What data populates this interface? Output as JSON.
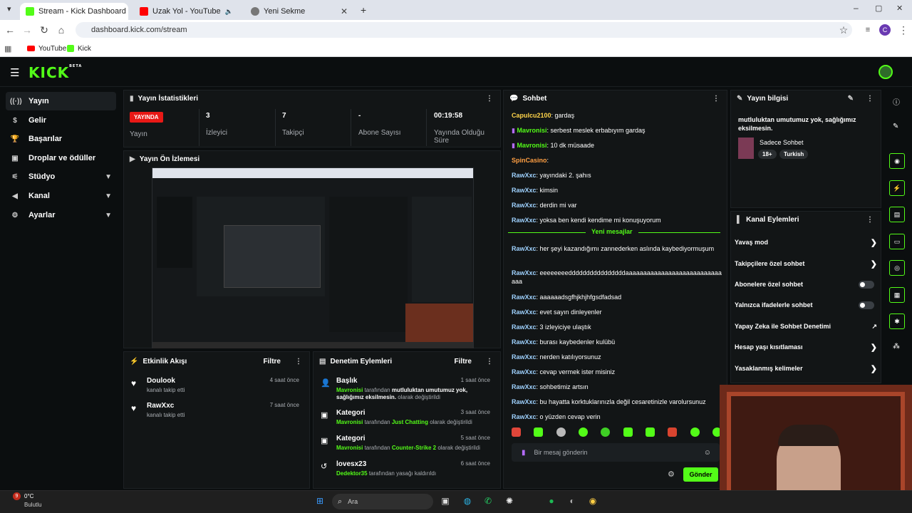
{
  "browser": {
    "tabs": [
      {
        "title": "Stream - Kick Dashboard",
        "color": "#53fc18"
      },
      {
        "title": "Uzak Yol - YouTube",
        "color": "#ff0000"
      },
      {
        "title": "Yeni Sekme",
        "color": "#777777"
      }
    ],
    "url": "dashboard.kick.com/stream",
    "bookmarks": [
      {
        "label": "YouTube"
      },
      {
        "label": "Kick"
      }
    ],
    "profile": "C"
  },
  "brand": {
    "logo": "KICK",
    "beta": "BETA",
    "accent": "#53fc18"
  },
  "sidebar": {
    "items": [
      {
        "label": "Yayın",
        "icon": "broadcast-icon",
        "active": true
      },
      {
        "label": "Gelir",
        "icon": "dollar-icon"
      },
      {
        "label": "Başarılar",
        "icon": "trophy-icon"
      },
      {
        "label": "Droplar ve ödüller",
        "icon": "gift-icon"
      },
      {
        "label": "Stüdyo",
        "icon": "sliders-icon",
        "expandable": true
      },
      {
        "label": "Kanal",
        "icon": "megaphone-icon",
        "expandable": true
      },
      {
        "label": "Ayarlar",
        "icon": "gear-icon",
        "expandable": true
      }
    ]
  },
  "stats": {
    "title": "Yayın İstatistikleri",
    "items": [
      {
        "value": "YAYINDA",
        "label": "Yayın"
      },
      {
        "value": "3",
        "label": "İzleyici"
      },
      {
        "value": "7",
        "label": "Takipçi"
      },
      {
        "value": "-",
        "label": "Abone Sayısı"
      },
      {
        "value": "00:19:58",
        "label": "Yayında Olduğu Süre"
      }
    ]
  },
  "preview": {
    "title": "Yayın Ön İzlemesi"
  },
  "activity": {
    "title": "Etkinlik Akışı",
    "filter": "Filtre",
    "items": [
      {
        "name": "Doulook",
        "desc": "kanalı takip etti",
        "time": "4 saat önce"
      },
      {
        "name": "RawXxc",
        "desc": "kanalı takip etti",
        "time": "7 saat önce"
      }
    ]
  },
  "moderation": {
    "title": "Denetim Eylemleri",
    "filter": "Filtre",
    "items": [
      {
        "title": "Başlık",
        "time": "1 saat önce",
        "user": "Mavronisi",
        "mid": "tarafından",
        "value": "mutluluktan umutumuz yok, sağlığımız eksilmesin.",
        "tail": "olarak değiştirildi",
        "icon": "person-icon"
      },
      {
        "title": "Kategori",
        "time": "3 saat önce",
        "user": "Mavronisi",
        "mid": "tarafından",
        "value": "Just Chatting",
        "tail": "olarak değiştirildi",
        "icon": "category-icon"
      },
      {
        "title": "Kategori",
        "time": "5 saat önce",
        "user": "Mavronisi",
        "mid": "tarafından",
        "value": "Counter-Strike 2",
        "tail": "olarak değiştirildi",
        "icon": "category-icon"
      },
      {
        "title": "lovesx23",
        "time": "6 saat önce",
        "user": "Dedektor35",
        "mid": "tarafından yasağı kaldırıldı",
        "value": "",
        "tail": "",
        "icon": "undo-icon"
      }
    ]
  },
  "chat": {
    "title": "Sohbet",
    "messages": [
      {
        "user": "Capulcu2100",
        "color": "#ffd44a",
        "text": "gardaş"
      },
      {
        "user": "Mavronisi",
        "color": "#53fc18",
        "text": "serbest meslek erbabıyım gardaş",
        "mic": true
      },
      {
        "user": "Mavronisi",
        "color": "#53fc18",
        "text": "10 dk müsaade",
        "mic": true
      },
      {
        "user": "SpinCasino",
        "color": "#ff9f43",
        "text": ""
      },
      {
        "user": "RawXxc",
        "color": "#9fd2ff",
        "text": "yayındaki 2. şahıs"
      },
      {
        "user": "RawXxc",
        "color": "#9fd2ff",
        "text": "kimsin"
      },
      {
        "user": "RawXxc",
        "color": "#9fd2ff",
        "text": "derdin mi var"
      },
      {
        "user": "RawXxc",
        "color": "#9fd2ff",
        "text": "yoksa ben kendi kendime mi konuşuyorum"
      }
    ],
    "newMessages": "Yeni mesajlar",
    "messages2": [
      {
        "user": "RawXxc",
        "color": "#9fd2ff",
        "text": "her şeyi kazandığımı zannederken aslında kaybediyormuşum"
      },
      {
        "user": "RawXxc",
        "color": "#9fd2ff",
        "text": "eeeeeeeeddddddddddddddddaaaaaaaaaaaaaaaaaaaaaaaaaaaaaa"
      },
      {
        "user": "RawXxc",
        "color": "#9fd2ff",
        "text": "aaaaaadsgfhjkhjhfgsdfadsad"
      },
      {
        "user": "RawXxc",
        "color": "#9fd2ff",
        "text": "evet sayın dinleyenler"
      },
      {
        "user": "RawXxc",
        "color": "#9fd2ff",
        "text": "3 izleyiciye ulaştık"
      },
      {
        "user": "RawXxc",
        "color": "#9fd2ff",
        "text": "burası kaybedenler kulübü"
      },
      {
        "user": "RawXxc",
        "color": "#9fd2ff",
        "text": "nerden katılıyorsunuz"
      },
      {
        "user": "RawXxc",
        "color": "#9fd2ff",
        "text": "cevap vermek ister misiniz"
      },
      {
        "user": "RawXxc",
        "color": "#9fd2ff",
        "text": "sohbetimiz artsın"
      },
      {
        "user": "RawXxc",
        "color": "#9fd2ff",
        "text": "bu hayatta korktuklarınızla değil cesaretinizle varolursunuz"
      },
      {
        "user": "RawXxc",
        "color": "#9fd2ff",
        "text": "o yüzden cevap verin"
      }
    ],
    "placeholder": "Bir mesaj gönderin",
    "send": "Gönder"
  },
  "info": {
    "title": "Yayın bilgisi",
    "streamTitle": "mutluluktan umutumuz yok, sağlığımız eksilmesin.",
    "category": "Sadece Sohbet",
    "tags": [
      "18+",
      "Turkish"
    ]
  },
  "channelActions": {
    "title": "Kanal Eylemleri",
    "items": [
      {
        "label": "Yavaş mod",
        "type": "chevron"
      },
      {
        "label": "Takipçilere özel sohbet",
        "type": "chevron"
      },
      {
        "label": "Abonelere özel sohbet",
        "type": "toggle"
      },
      {
        "label": "Yalnızca ifadelerle sohbet",
        "type": "toggle"
      },
      {
        "label": "Yapay Zeka ile Sohbet Denetimi",
        "type": "external"
      },
      {
        "label": "Hesap yaşı kısıtlaması",
        "type": "chevron"
      },
      {
        "label": "Yasaklanmış kelimeler",
        "type": "chevron"
      }
    ]
  },
  "taskbar": {
    "weather": {
      "temp": "0°C",
      "desc": "Bulutlu",
      "badge": "9"
    },
    "search": "Ara"
  }
}
